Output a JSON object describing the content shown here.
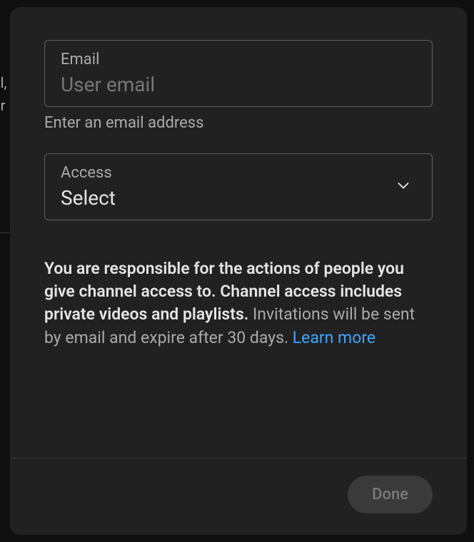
{
  "background": {
    "line1": "el,",
    "line2": "er"
  },
  "dialog": {
    "email": {
      "label": "Email",
      "placeholder": "User email",
      "helper": "Enter an email address"
    },
    "access": {
      "label": "Access",
      "value": "Select"
    },
    "info": {
      "bold": "You are responsible for the actions of people you give channel access to. Channel access includes private videos and playlists.",
      "regular": " Invitations will be sent by email and expire after 30 days. ",
      "link": "Learn more"
    },
    "footer": {
      "done": "Done"
    }
  }
}
